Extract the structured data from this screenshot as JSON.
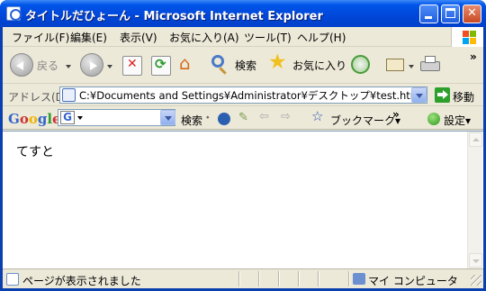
{
  "window": {
    "title": "タイトルだひょーん - Microsoft Internet Explorer",
    "colors": {
      "titlebar": "#0046d8",
      "chrome": "#ece9d8",
      "close": "#c94a24"
    }
  },
  "menu": {
    "items": [
      "ファイル(F)",
      "編集(E)",
      "表示(V)",
      "お気に入り(A)",
      "ツール(T)",
      "ヘルプ(H)"
    ]
  },
  "toolbar": {
    "back_label": "戻る",
    "search_label": "検索",
    "favorites_label": "お気に入り",
    "more": "»"
  },
  "address": {
    "label": "アドレス(D)",
    "url": "C:¥Documents and Settings¥Administrator¥デスクトップ¥test.html",
    "go_label": "移動"
  },
  "googlebar": {
    "logo": "Google",
    "search_label": "検索",
    "bookmarks_label": "ブックマーク▾",
    "more": "»",
    "settings_label": "設定▾"
  },
  "content": {
    "text": "てすと"
  },
  "status": {
    "text": "ページが表示されました",
    "zone": "マイ コンピュータ"
  }
}
